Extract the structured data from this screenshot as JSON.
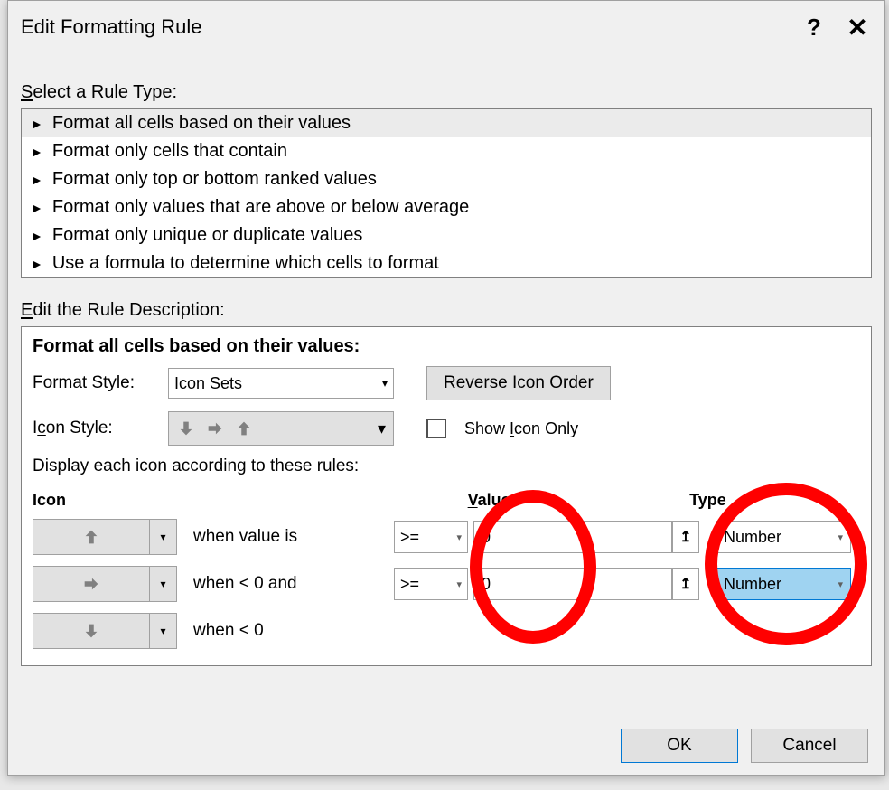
{
  "dialog": {
    "title": "Edit Formatting Rule",
    "help_symbol": "?",
    "close_symbol": "✕"
  },
  "rule_type": {
    "label_pre": "S",
    "label_rest": "elect a Rule Type:",
    "items": [
      "Format all cells based on their values",
      "Format only cells that contain",
      "Format only top or bottom ranked values",
      "Format only values that are above or below average",
      "Format only unique or duplicate values",
      "Use a formula to determine which cells to format"
    ]
  },
  "rule_desc": {
    "label_pre": "E",
    "label_rest": "dit the Rule Description:",
    "heading": "Format all cells based on their values:",
    "format_style_label": "Format Style:",
    "format_style_value": "Icon Sets",
    "reverse_btn": "Reverse Icon Order",
    "icon_style_label_pre": "I",
    "icon_style_label_mid": "c",
    "icon_style_label_rest": "on Style:",
    "show_icon_only_pre": "Show ",
    "show_icon_only_mid": "I",
    "show_icon_only_rest": "con Only",
    "display_each": "Display each icon according to these rules:",
    "col_icon": "Icon",
    "col_value_pre": "V",
    "col_value_rest": "alue",
    "col_type": "Type",
    "rows": [
      {
        "when": "when value is",
        "op": ">=",
        "value": "0",
        "type": "Number"
      },
      {
        "when": "when < 0 and",
        "op": ">=",
        "value": "0",
        "type": "Number"
      },
      {
        "when": "when < 0"
      }
    ]
  },
  "footer": {
    "ok": "OK",
    "cancel": "Cancel"
  }
}
